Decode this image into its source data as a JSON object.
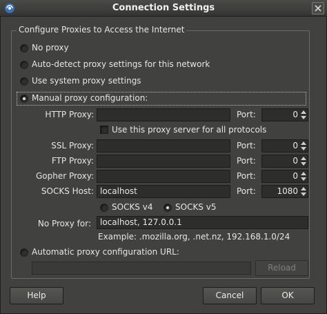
{
  "window": {
    "title": "Connection Settings"
  },
  "group": {
    "title": "Configure Proxies to Access the Internet"
  },
  "options": {
    "no_proxy": "No proxy",
    "auto_detect": "Auto-detect proxy settings for this network",
    "system": "Use system proxy settings",
    "manual": "Manual proxy configuration:",
    "auto_url": "Automatic proxy configuration URL:",
    "selected": "manual"
  },
  "manual": {
    "http_label": "HTTP Proxy:",
    "http_value": "",
    "http_port": "0",
    "same_proxy_label": "Use this proxy server for all protocols",
    "same_proxy_checked": false,
    "ssl_label": "SSL Proxy:",
    "ssl_value": "",
    "ssl_port": "0",
    "ftp_label": "FTP Proxy:",
    "ftp_value": "",
    "ftp_port": "0",
    "gopher_label": "Gopher Proxy:",
    "gopher_value": "",
    "gopher_port": "0",
    "socks_label": "SOCKS Host:",
    "socks_value": "localhost",
    "socks_port": "1080",
    "port_label": "Port:",
    "socks_v4": "SOCKS v4",
    "socks_v5": "SOCKS v5",
    "socks_selected": "v5",
    "no_proxy_label": "No Proxy for:",
    "no_proxy_value": "localhost, 127.0.0.1",
    "example": "Example: .mozilla.org, .net.nz, 192.168.1.0/24"
  },
  "auto": {
    "url_value": "",
    "reload": "Reload"
  },
  "buttons": {
    "help": "Help",
    "cancel": "Cancel",
    "ok": "OK"
  },
  "icons": {
    "app": "app-icon",
    "close": "close-icon"
  }
}
